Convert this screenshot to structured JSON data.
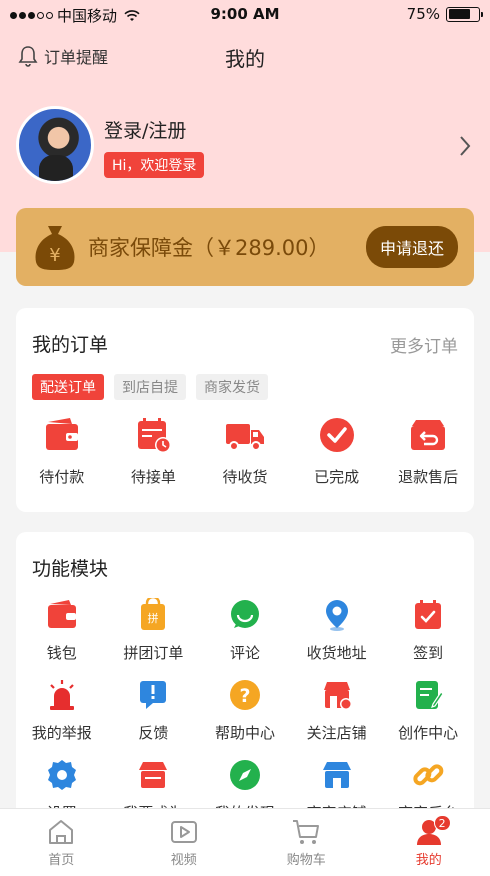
{
  "status": {
    "carrier": "中国移动",
    "time": "9:00 AM",
    "battery": "75%",
    "battery_level": 0.75
  },
  "nav": {
    "notice_label": "订单提醒",
    "title": "我的"
  },
  "profile": {
    "login_label": "登录/注册",
    "welcome": "Hi，欢迎登录"
  },
  "deposit": {
    "label": "商家保障金（￥289.00）",
    "refund_label": "申请退还"
  },
  "orders": {
    "title": "我的订单",
    "more": "更多订单",
    "tabs": [
      "配送订单",
      "到店自提",
      "商家发货"
    ],
    "items": [
      {
        "label": "待付款",
        "icon": "wallet-icon"
      },
      {
        "label": "待接单",
        "icon": "calendar-clock-icon"
      },
      {
        "label": "待收货",
        "icon": "truck-icon"
      },
      {
        "label": "已完成",
        "icon": "check-circle-icon"
      },
      {
        "label": "退款售后",
        "icon": "return-box-icon"
      }
    ]
  },
  "features": {
    "title": "功能模块",
    "items": [
      {
        "label": "钱包",
        "icon": "wallet-icon"
      },
      {
        "label": "拼团订单",
        "icon": "group-bag-icon"
      },
      {
        "label": "评论",
        "icon": "chat-icon"
      },
      {
        "label": "收货地址",
        "icon": "location-icon"
      },
      {
        "label": "签到",
        "icon": "calendar-check-icon"
      },
      {
        "label": "我的举报",
        "icon": "alarm-icon"
      },
      {
        "label": "反馈",
        "icon": "feedback-icon"
      },
      {
        "label": "帮助中心",
        "icon": "help-icon"
      },
      {
        "label": "关注店铺",
        "icon": "store-follow-icon"
      },
      {
        "label": "创作中心",
        "icon": "edit-doc-icon"
      },
      {
        "label": "设置",
        "icon": "gear-icon"
      },
      {
        "label": "我要成为",
        "icon": "shop-icon"
      },
      {
        "label": "我的发现",
        "icon": "compass-icon"
      },
      {
        "label": "商家店铺",
        "icon": "merchant-store-icon"
      },
      {
        "label": "商家后台",
        "icon": "link-icon"
      }
    ]
  },
  "tabbar": {
    "items": [
      {
        "label": "首页",
        "icon": "home-icon"
      },
      {
        "label": "视频",
        "icon": "video-icon"
      },
      {
        "label": "购物车",
        "icon": "cart-icon"
      },
      {
        "label": "我的",
        "icon": "user-icon",
        "badge": "2"
      }
    ]
  },
  "colors": {
    "accent": "#f0433a",
    "header_bg": "#ffdcdc",
    "deposit_bg": "#e3b063",
    "deposit_btn": "#7b4a07"
  }
}
